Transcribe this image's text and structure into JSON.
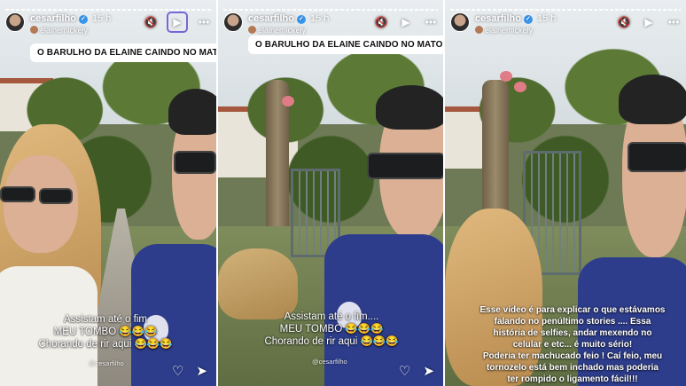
{
  "story": {
    "username": "cesarfilho",
    "verified_mark": "✓",
    "time_ago": "15 h",
    "music_or_collab": "elainemickely",
    "handle_watermark": "@cesarfilho"
  },
  "panels": [
    {
      "caption": "O BARULHO DA ELAINE CAINDO NO MATO 😂",
      "overlay_lines": [
        "Assistam até o fim",
        "MEU TOMBO 😂😂😂",
        "Chorando de rir aqui 😂😂😂"
      ]
    },
    {
      "caption": "O BARULHO DA ELAINE CAINDO NO MATO 😂",
      "overlay_lines": [
        "Assistam até o fim....",
        "MEU TOMBO 😂😂😂",
        "Chorando de rir aqui 😂😂😂"
      ]
    },
    {
      "overlay_lines": [
        "Esse vídeo é para explicar o que estávamos",
        "falando no penúltimo stories .... Essa",
        "história de selfies, andar mexendo no",
        "celular e etc... é muito sério!",
        "Poderia ter machucado feio ! Caí feio, meu",
        "tornozelo está bem inchado mas poderia",
        "ter rompido o ligamento fácil!!!"
      ]
    }
  ],
  "icons": {
    "mute": "🔇",
    "play": "▶",
    "more": "•••",
    "like": "♡",
    "share": "➤"
  },
  "colors": {
    "highlight_outline": "#7b66d6",
    "shirt_blue": "#2d3d8c",
    "verified_blue": "#3897f0"
  }
}
